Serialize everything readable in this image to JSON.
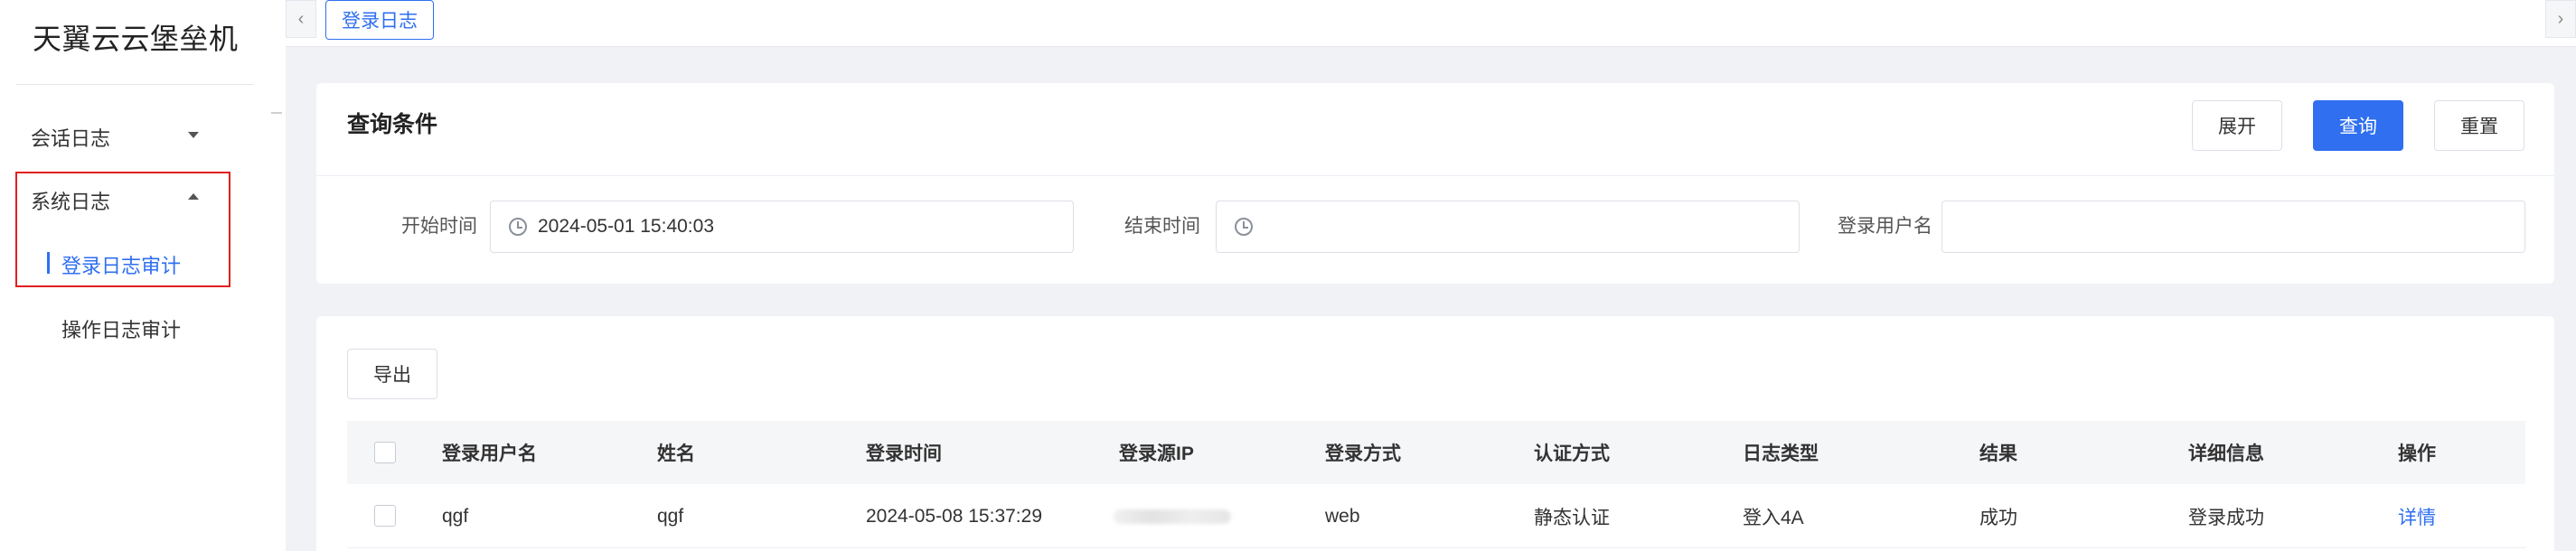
{
  "app": {
    "title": "天翼云云堡垒机"
  },
  "sidebar": {
    "groups": [
      {
        "label": "会话日志",
        "expanded": false
      },
      {
        "label": "系统日志",
        "expanded": true
      }
    ],
    "items": [
      {
        "label": "登录日志审计",
        "active": true
      },
      {
        "label": "操作日志审计",
        "active": false
      }
    ]
  },
  "tabs": [
    {
      "label": "登录日志"
    }
  ],
  "query": {
    "title": "查询条件",
    "buttons": {
      "expand": "展开",
      "search": "查询",
      "reset": "重置"
    },
    "fields": {
      "start_time": {
        "label": "开始时间",
        "value": "2024-05-01 15:40:03"
      },
      "end_time": {
        "label": "结束时间",
        "value": ""
      },
      "username": {
        "label": "登录用户名",
        "value": ""
      }
    }
  },
  "results": {
    "export_label": "导出",
    "columns": [
      "登录用户名",
      "姓名",
      "登录时间",
      "登录源IP",
      "登录方式",
      "认证方式",
      "日志类型",
      "结果",
      "详细信息",
      "操作"
    ],
    "rows": [
      {
        "username": "qgf",
        "name": "qgf",
        "time": "2024-05-08 15:37:29",
        "ip": "",
        "method": "web",
        "auth": "静态认证",
        "type": "登入4A",
        "result": "成功",
        "detail": "登录成功",
        "action": "详情"
      }
    ]
  },
  "colors": {
    "accent": "#2f6ff0",
    "highlight": "#e02020",
    "background": "#f0f2f5"
  },
  "icons": {
    "tab_prev": "chevron-left-icon",
    "tab_next": "chevron-right-icon",
    "time": "clock-icon",
    "collapsed": "caret-down-icon",
    "expanded": "caret-up-icon"
  }
}
